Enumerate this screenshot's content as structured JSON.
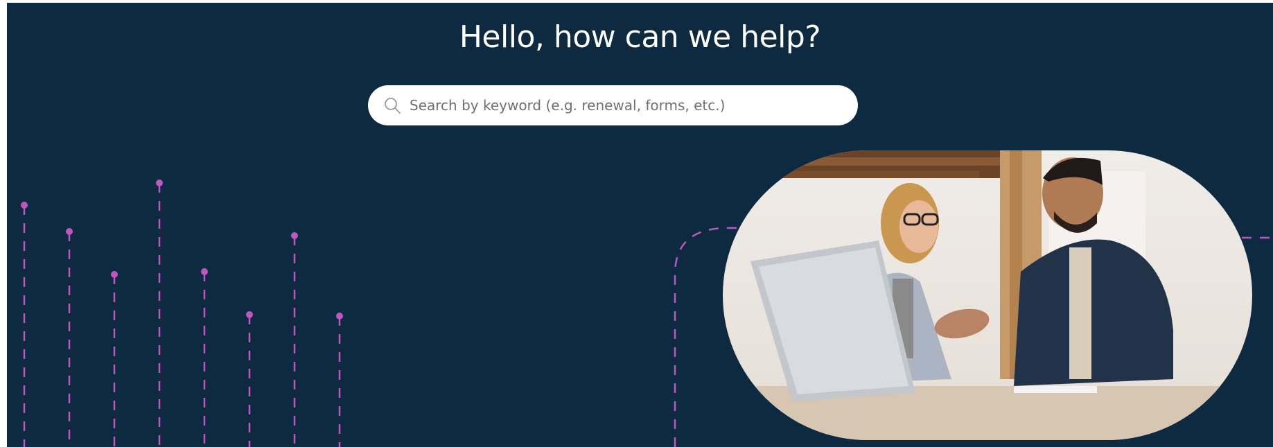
{
  "hero": {
    "title": "Hello, how can we help?",
    "search": {
      "placeholder": "Search by keyword (e.g. renewal, forms, etc.)",
      "icon": "search-icon"
    }
  },
  "colors": {
    "background": "#0e2a40",
    "accent": "#c056c0",
    "search_bg": "#ffffff"
  }
}
